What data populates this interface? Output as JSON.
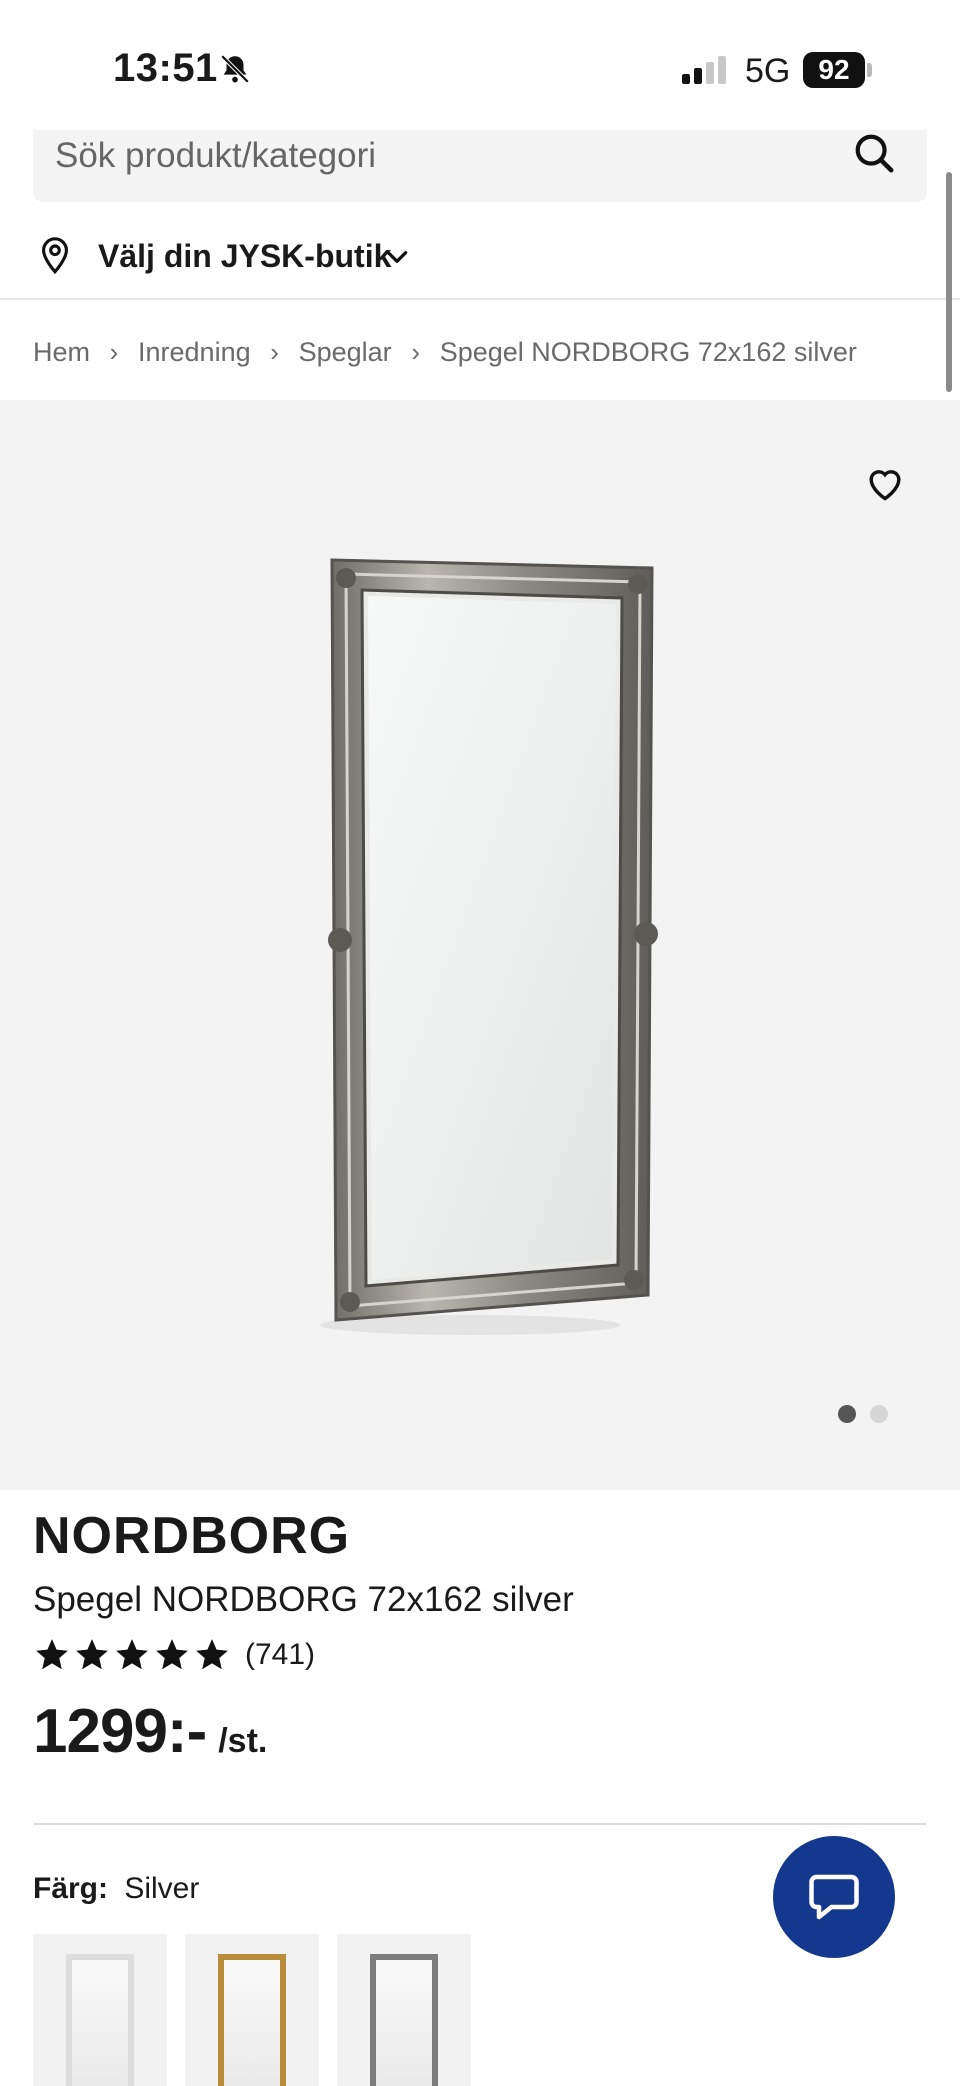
{
  "status_bar": {
    "time": "13:51",
    "network": "5G",
    "battery": "92"
  },
  "search": {
    "placeholder": "Sök produkt/kategori"
  },
  "store": {
    "label": "Välj din JYSK-butik"
  },
  "breadcrumb": {
    "items": [
      "Hem",
      "Inredning",
      "Speglar",
      "Spegel NORDBORG 72x162 silver"
    ],
    "separator": "›"
  },
  "gallery": {
    "image_count": 2,
    "active_index": 0
  },
  "product": {
    "brand": "NORDBORG",
    "name": "Spegel NORDBORG 72x162 silver",
    "rating_stars": 5,
    "review_count": "(741)",
    "price": "1299:-",
    "price_unit": "/st."
  },
  "variants": {
    "color_label": "Färg:",
    "color_value": "Silver",
    "swatches": [
      "silver",
      "gold",
      "grey"
    ]
  },
  "colors": {
    "chat_button": "#15388f",
    "gallery_bg": "#f3f3f3"
  }
}
